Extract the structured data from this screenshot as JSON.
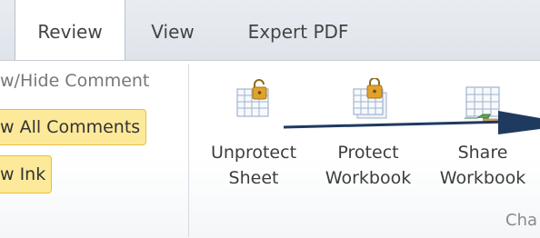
{
  "tabs": [
    "Review",
    "View",
    "Expert PDF"
  ],
  "comments_group": {
    "show_hide_comment": "w/Hide Comment",
    "show_all_comments": "w All Comments",
    "show_ink": "w Ink"
  },
  "changes_group": {
    "unprotect_sheet": {
      "line1": "Unprotect",
      "line2": "Sheet"
    },
    "protect_workbook": {
      "line1": "Protect",
      "line2": "Workbook"
    },
    "share_workbook": {
      "line1": "Share",
      "line2": "Workbook"
    },
    "label": "Cha"
  },
  "colors": {
    "highlight_fill": "#fde99a",
    "highlight_border": "#e9be3f",
    "lock_gold": "#e0a22a",
    "arrow": "#1f3a5f"
  }
}
